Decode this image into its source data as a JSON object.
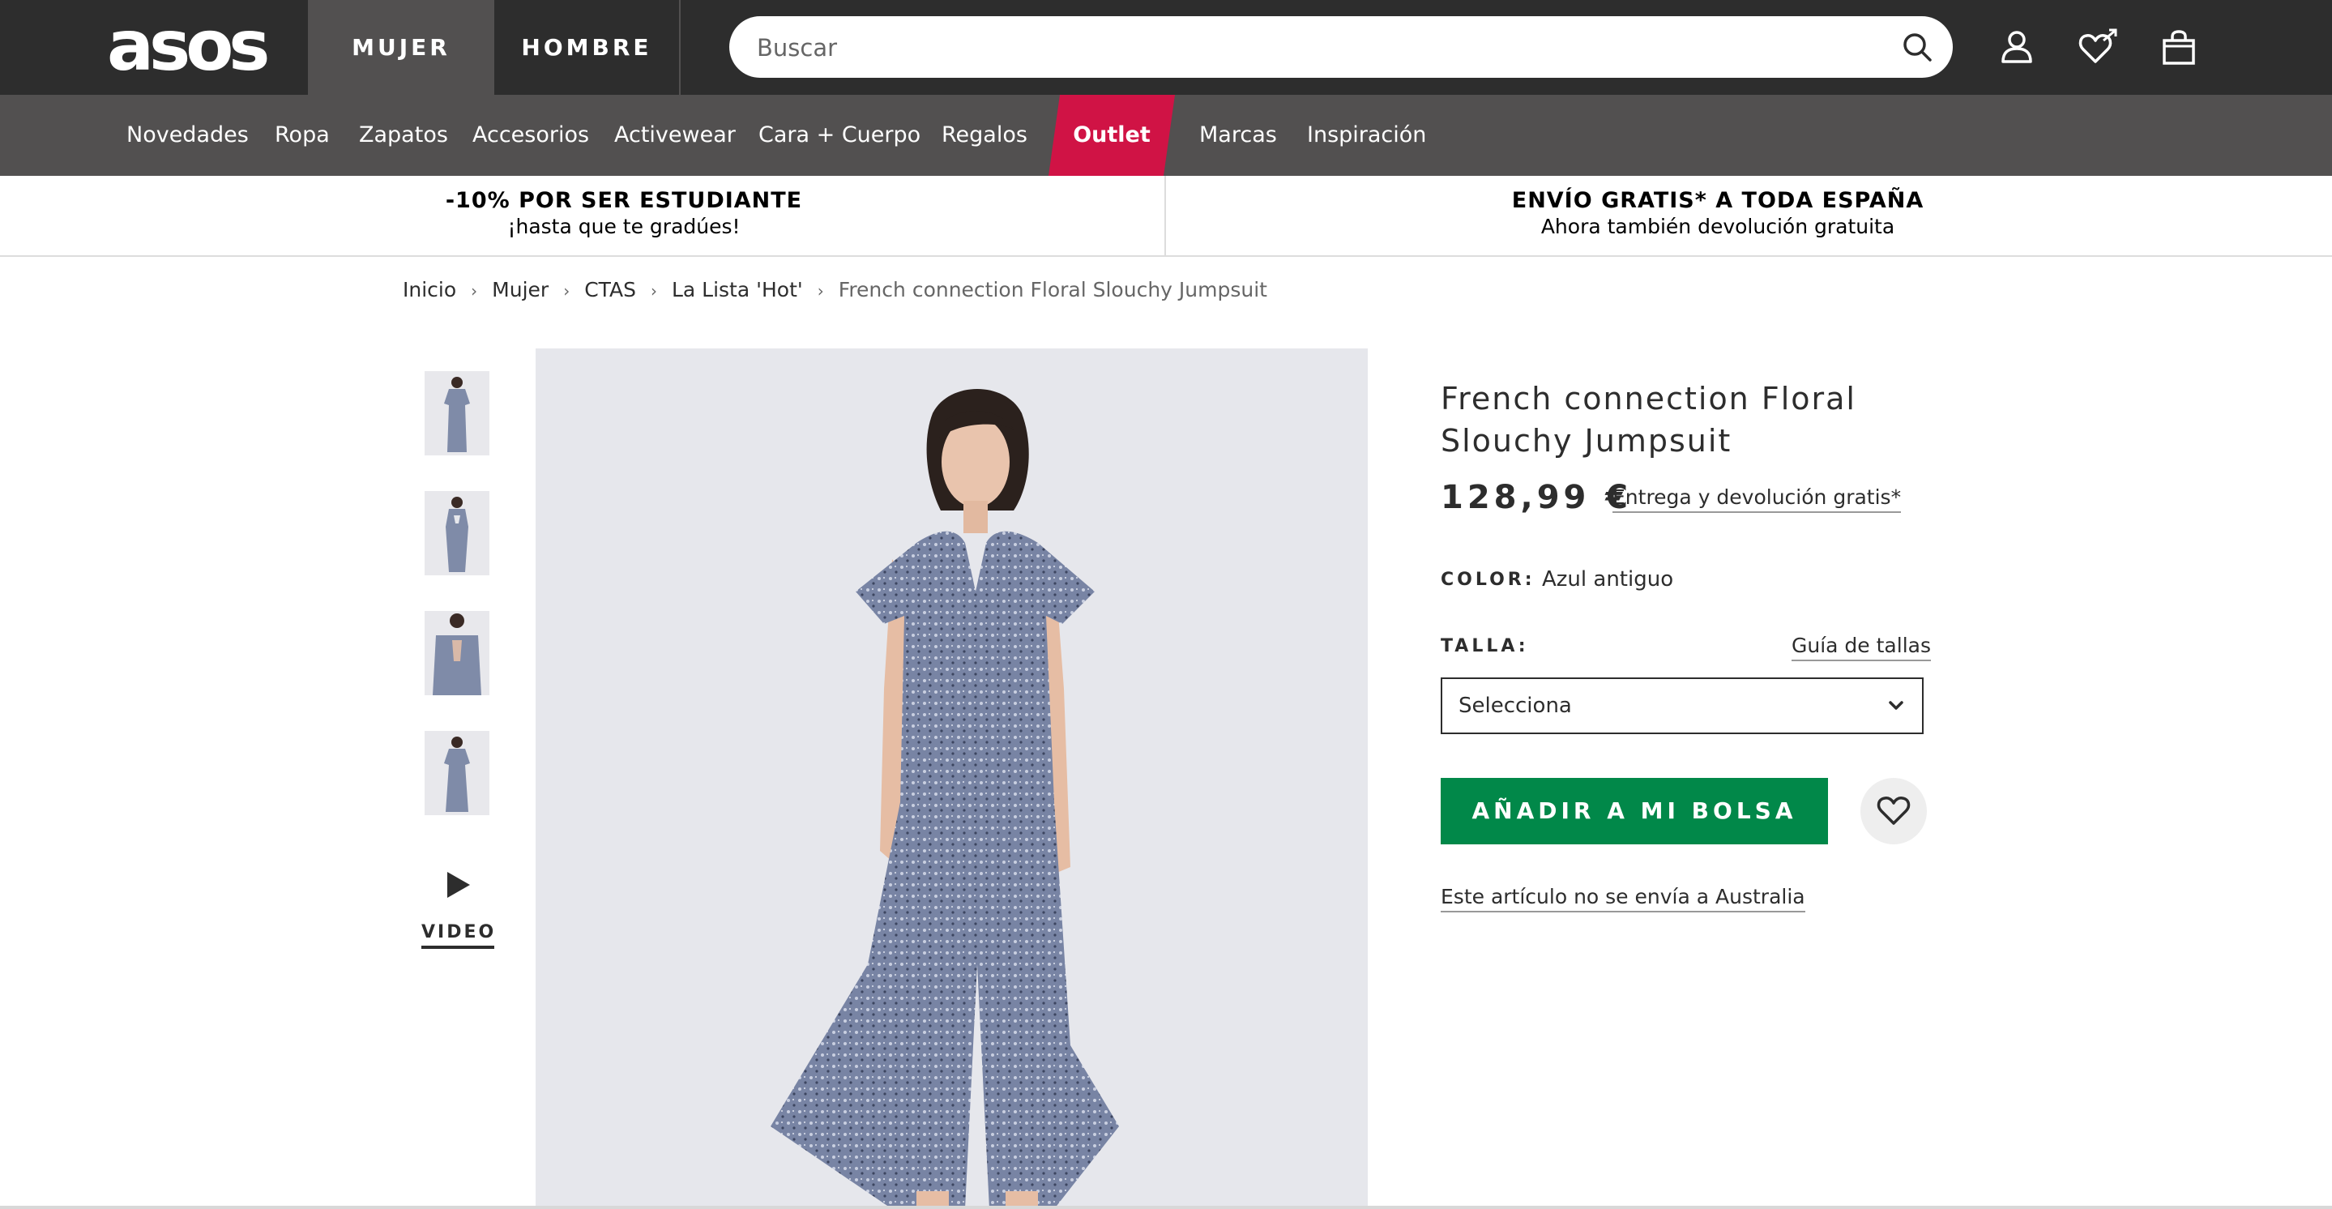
{
  "header": {
    "logo": "asos",
    "tabs": [
      "MUJER",
      "HOMBRE"
    ],
    "search_placeholder": "Buscar",
    "icons": [
      "search-icon",
      "account-icon",
      "saved-items-icon",
      "bag-icon"
    ]
  },
  "categories": {
    "novedades": "Novedades",
    "ropa": "Ropa",
    "zapatos": "Zapatos",
    "accesorios": "Accesorios",
    "activewear": "Activewear",
    "cara": "Cara + Cuerpo",
    "regalos": "Regalos",
    "outlet": "Outlet",
    "marcas": "Marcas",
    "inspiracion": "Inspiración"
  },
  "promos": {
    "left": {
      "title": "-10% POR SER ESTUDIANTE",
      "subtitle": "¡hasta que te gradúes!"
    },
    "right": {
      "title": "ENVÍO GRATIS* A TODA ESPAÑA",
      "subtitle": "Ahora también devolución gratuita"
    }
  },
  "breadcrumb": [
    "Inicio",
    "Mujer",
    "CTAS",
    "La Lista 'Hot'",
    "French connection Floral Slouchy Jumpsuit"
  ],
  "gallery": {
    "video_label": "VIDEO"
  },
  "product": {
    "title": "French connection Floral Slouchy Jumpsuit",
    "price": "128,99 €",
    "delivery_link": "Entrega y devolución gratis*",
    "color_label": "COLOR:",
    "color_value": "Azul antiguo",
    "size_label": "TALLA:",
    "size_guide": "Guía de tallas",
    "size_select_value": "Selecciona",
    "add_to_bag": "AÑADIR A MI BOLSA",
    "shipping_note": "Este artículo no se envía a Australia"
  },
  "colors": {
    "topbar": "#2d2d2d",
    "nav": "#525050",
    "outlet": "#d01345",
    "add_to_bag": "#018849"
  }
}
